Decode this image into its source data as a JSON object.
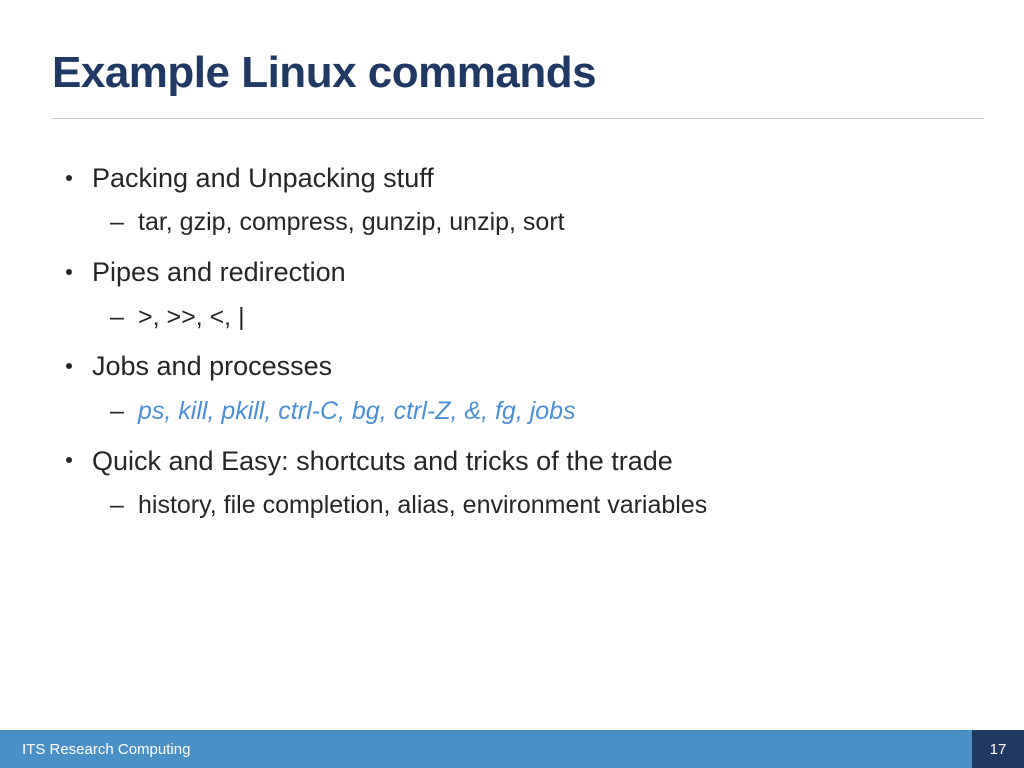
{
  "title": "Example Linux commands",
  "bullets": [
    {
      "label": "Packing and Unpacking stuff",
      "sub": [
        {
          "text": "tar, gzip, compress, gunzip, unzip, sort",
          "accent": false
        }
      ]
    },
    {
      "label": "Pipes and redirection",
      "sub": [
        {
          "text": ">, >>, <, |",
          "accent": false
        }
      ]
    },
    {
      "label": "Jobs and processes",
      "sub": [
        {
          "text": "ps, kill, pkill, ctrl-C, bg, ctrl-Z, &, fg, jobs",
          "accent": true
        }
      ]
    },
    {
      "label": "Quick and Easy: shortcuts and tricks of the trade",
      "sub": [
        {
          "text": "history, file completion, alias, environment variables",
          "accent": false
        }
      ]
    }
  ],
  "footer": {
    "org": "ITS Research Computing",
    "page": "17"
  }
}
